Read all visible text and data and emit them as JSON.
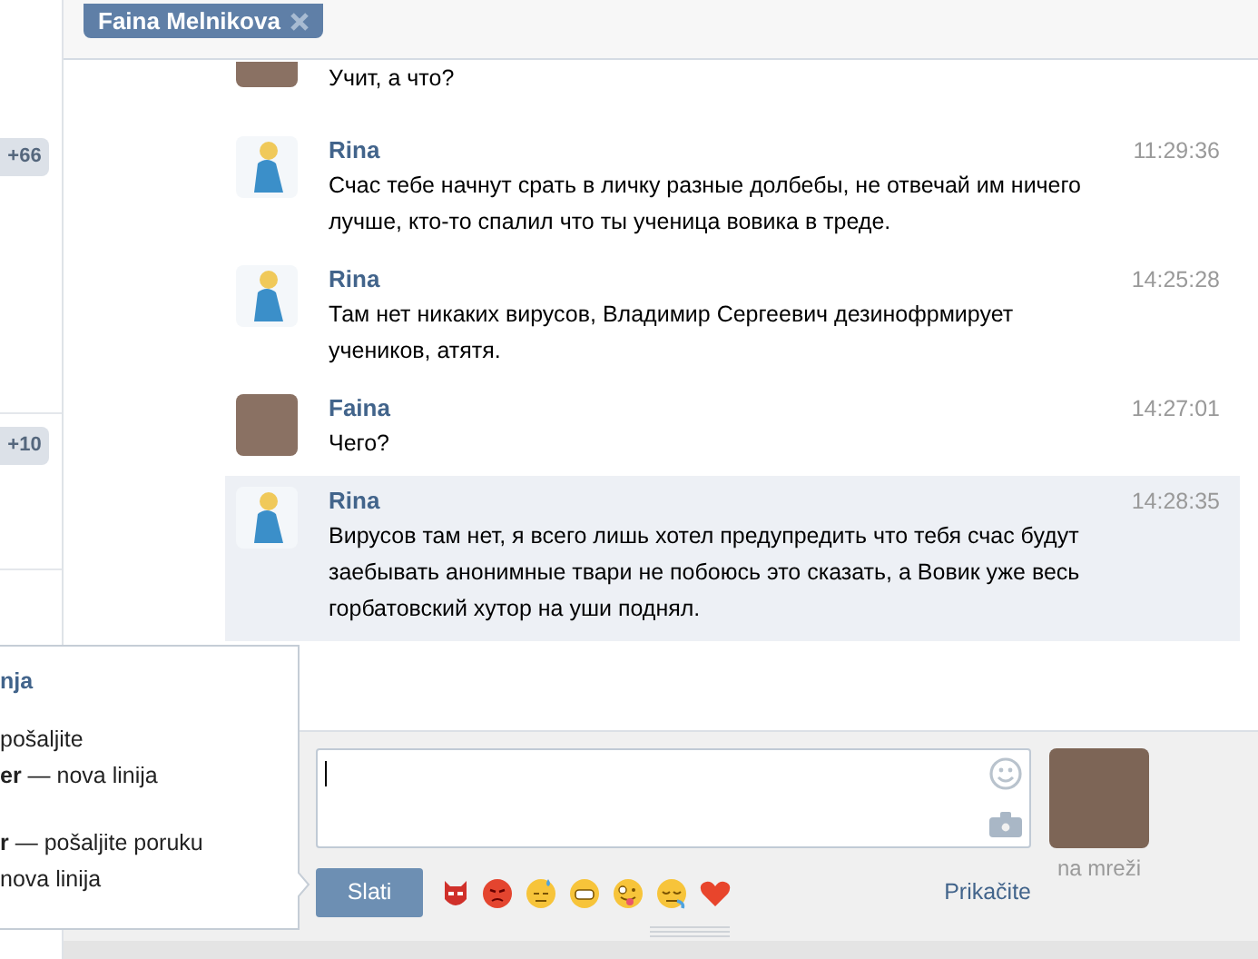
{
  "sidebar": {
    "badges": [
      "+66",
      "+10"
    ]
  },
  "header": {
    "tab": {
      "label": "Faina Melnikova"
    }
  },
  "messages": [
    {
      "kind": "photo",
      "text": "Учит, а что?",
      "highlighted": false,
      "cut": true
    },
    {
      "kind": "drawing",
      "author": "Rina",
      "time": "11:29:36",
      "text": "Счас тебе начнут срать в личку разные долбебы, не отвечай им ничего лучше, кто-то спалил что ты ученица вовика в треде.",
      "highlighted": false,
      "cut": false
    },
    {
      "kind": "drawing",
      "author": "Rina",
      "time": "14:25:28",
      "text": "Там нет никаких вирусов, Владимир Сергеевич дезинофрмирует учеников, атятя.",
      "highlighted": false,
      "cut": false
    },
    {
      "kind": "photo",
      "author": "Faina",
      "time": "14:27:01",
      "text": "Чего?",
      "highlighted": false,
      "cut": false
    },
    {
      "kind": "drawing",
      "author": "Rina",
      "time": "14:28:35",
      "text": "Вирусов там нет, я всего лишь хотел предупредить что тебя счас будут заебывать анонимные твари не побоюсь это сказать, а Вовик уже весь горбатовский хутор на уши поднял.",
      "highlighted": true,
      "cut": false
    }
  ],
  "composer": {
    "send_button": "Slati",
    "attach_link": "Prikačite",
    "status": "na mreži"
  },
  "tooltip": {
    "title": "nja",
    "groups": [
      [
        "pošaljite",
        "**er** — nova linija"
      ],
      [
        "**r** — pošaljite poruku",
        "nova linija"
      ]
    ]
  }
}
